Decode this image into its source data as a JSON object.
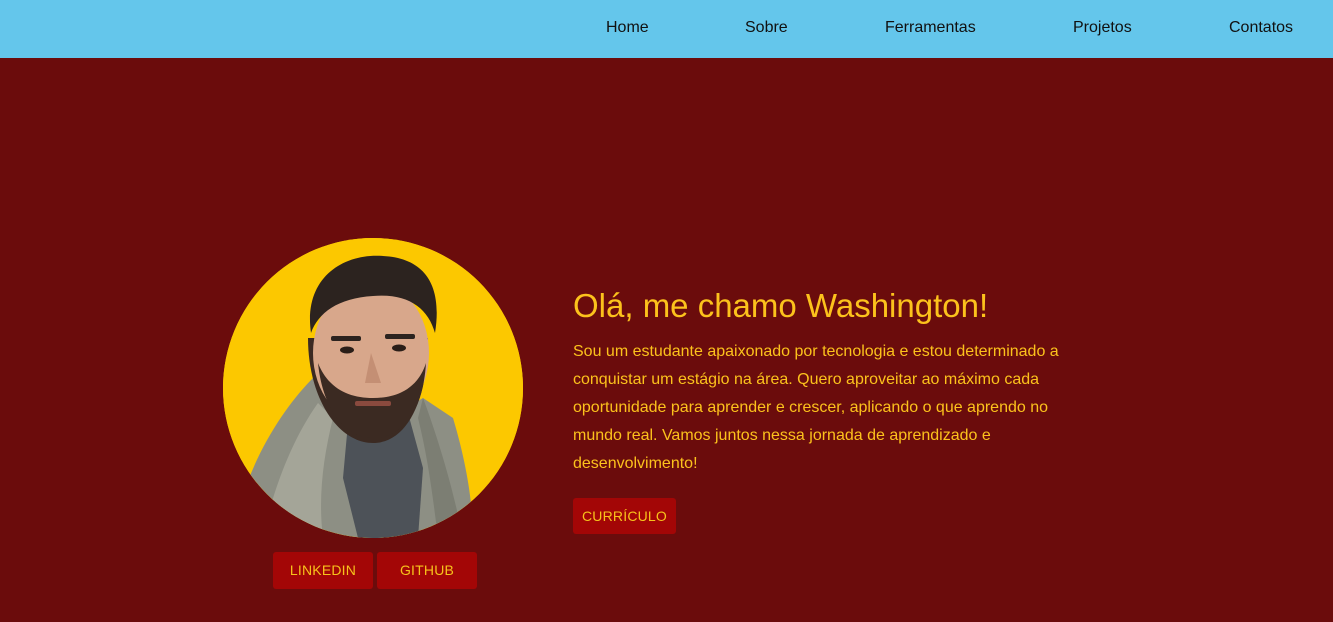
{
  "nav": {
    "items": [
      {
        "label": "Home"
      },
      {
        "label": "Sobre"
      },
      {
        "label": "Ferramentas"
      },
      {
        "label": "Projetos"
      },
      {
        "label": "Contatos"
      }
    ]
  },
  "hero": {
    "title": "Olá, me chamo Washington!",
    "bio": "Sou um estudante apaixonado por tecnologia e estou determinado a conquistar um estágio na área. Quero aproveitar ao máximo cada oportunidade para aprender e crescer, aplicando o que aprendo no mundo real. Vamos juntos nessa jornada de aprendizado e desenvolvimento!",
    "cv_button": "CURRÍCULO"
  },
  "social": {
    "linkedin_label": "LINKEDIN",
    "github_label": "GITHUB"
  },
  "colors": {
    "navbar": "#64c6eb",
    "background": "#6b0c0c",
    "accent_text": "#fcc21c",
    "button": "#a30606",
    "avatar_bg": "#fcc800"
  }
}
